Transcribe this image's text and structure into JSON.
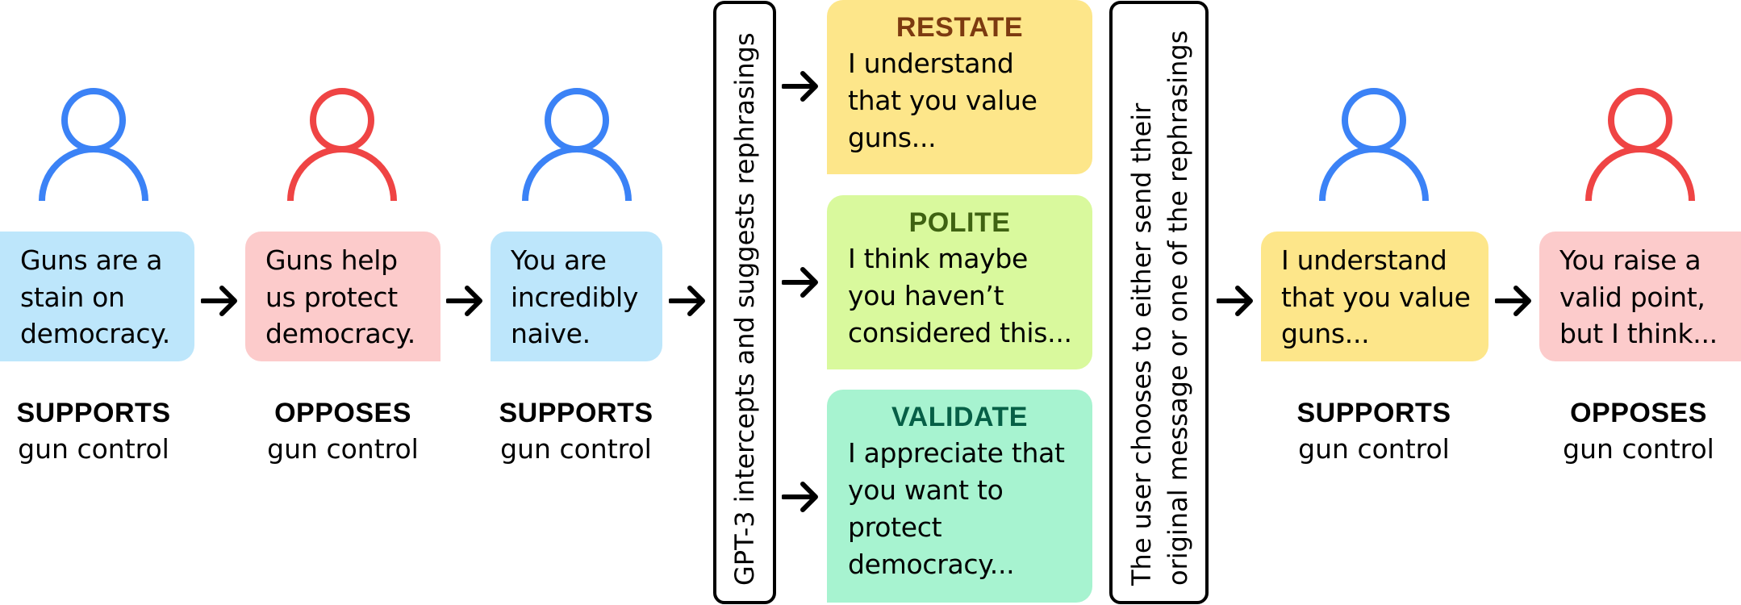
{
  "colors": {
    "supporter_blue": "#3b82f6",
    "opposer_red": "#ef4444",
    "bubble_blue": "#bde6fb",
    "bubble_pink": "#fccbcb",
    "bubble_yellow": "#fde68a",
    "bubble_green": "#d9f99d",
    "bubble_teal": "#a7f3d0",
    "restate_title": "#7c3a10",
    "polite_title": "#3f6212",
    "validate_title": "#065f46"
  },
  "conversation": [
    {
      "person": "blue-user-icon",
      "message": "Guns are a\nstain on\ndemocracy.",
      "stance": "SUPPORTS",
      "topic": "gun control"
    },
    {
      "person": "red-user-icon",
      "message": "Guns help\nus protect\ndemocracy.",
      "stance": "OPPOSES",
      "topic": "gun control"
    },
    {
      "person": "blue-user-icon",
      "message": "You are\nincredibly\nnaive.",
      "stance": "SUPPORTS",
      "topic": "gun control"
    }
  ],
  "intercept_step": {
    "text": "GPT-3 intercepts and suggests rephrasings"
  },
  "rephrasings": [
    {
      "title": "RESTATE",
      "text": "I understand\nthat you value\nguns..."
    },
    {
      "title": "POLITE",
      "text": "I think maybe\nyou haven’t\nconsidered this..."
    },
    {
      "title": "VALIDATE",
      "text": "I appreciate that\nyou want to\nprotect\ndemocracy..."
    }
  ],
  "choice_step": {
    "line1": "The user chooses to either send their",
    "line2": "original message or one of the rephrasings"
  },
  "outcome": [
    {
      "person": "blue-user-icon",
      "message": "I understand\nthat you value\nguns...",
      "stance": "SUPPORTS",
      "topic": "gun control"
    },
    {
      "person": "red-user-icon",
      "message": "You raise a\nvalid point,\nbut I think...",
      "stance": "OPPOSES",
      "topic": "gun control"
    }
  ],
  "icons": {
    "arrow": "right-arrow-icon",
    "person": "user-icon"
  }
}
